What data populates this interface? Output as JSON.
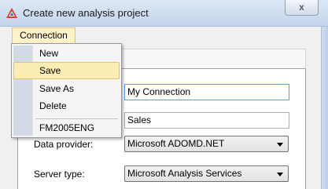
{
  "window": {
    "title": "Create new analysis project",
    "close_glyph": "x",
    "icon": "app-logo-icon"
  },
  "menubar": {
    "connection_label": "Connection"
  },
  "connection_menu": {
    "items": [
      {
        "label": "New"
      },
      {
        "label": "Save",
        "highlighted": true
      },
      {
        "label": "Save As"
      },
      {
        "label": "Delete"
      }
    ],
    "saved_connections": [
      {
        "label": "FM2005ENG"
      }
    ]
  },
  "form": {
    "connection_name_value": "My Connection",
    "cube_value": "Sales",
    "data_provider_label": "Data provider:",
    "data_provider_value": "Microsoft ADOMD.NET",
    "server_type_label": "Server type:",
    "server_type_value": "Microsoft Analysis Services"
  },
  "colors": {
    "menu_highlight": "#fcedb5",
    "menu_bar_active": "#fdf2c8",
    "gutter": "#d2dae8",
    "focus_border": "#569de5"
  }
}
